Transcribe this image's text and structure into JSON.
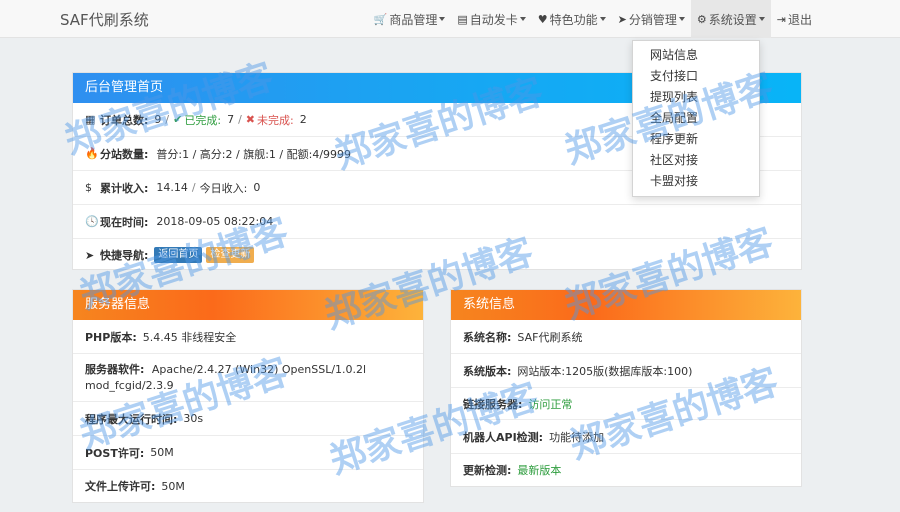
{
  "navbar": {
    "brand": "SAF代刷系统",
    "items": [
      {
        "icon": "cart-icon",
        "glyph": "🛒",
        "label": "商品管理",
        "dropdown": true
      },
      {
        "icon": "book-icon",
        "glyph": "▤",
        "label": "自动发卡",
        "dropdown": true
      },
      {
        "icon": "heart-icon",
        "glyph": "♥",
        "label": "特色功能",
        "dropdown": true
      },
      {
        "icon": "send-icon",
        "glyph": "➤",
        "label": "分销管理",
        "dropdown": true
      },
      {
        "icon": "gear-icon",
        "glyph": "⚙",
        "label": "系统设置",
        "dropdown": true
      },
      {
        "icon": "logout-icon",
        "glyph": "⇥",
        "label": "退出",
        "dropdown": false
      }
    ]
  },
  "dropdown": {
    "items": [
      "网站信息",
      "支付接口",
      "提现列表",
      "全局配置",
      "程序更新",
      "社区对接",
      "卡盟对接"
    ]
  },
  "dashboard": {
    "title": "后台管理首页",
    "orders_label": "订单总数:",
    "orders_total": "9",
    "done_label": "已完成:",
    "done_value": "7",
    "undone_label": "未完成:",
    "undone_value": "2",
    "sites_label": "分站数量:",
    "sites_value": "普分:1 / 高分:2 / 旗舰:1 / 配额:4/9999",
    "income_label": "累计收入:",
    "income_total": "14.14",
    "today_label": "今日收入:",
    "today_value": "0",
    "time_label": "现在时间:",
    "time_value": "2018-09-05 08:22:04",
    "quicknav_label": "快捷导航:",
    "btn_home": "返回首页",
    "btn_second": "检查更新"
  },
  "server": {
    "title": "服务器信息",
    "php_label": "PHP版本:",
    "php_value": "5.4.45 非线程安全",
    "software_label": "服务器软件:",
    "software_value": "Apache/2.4.27 (Win32) OpenSSL/1.0.2l mod_fcgid/2.3.9",
    "maxtime_label": "程序最大运行时间:",
    "maxtime_value": "30s",
    "post_label": "POST许可:",
    "post_value": "50M",
    "upload_label": "文件上传许可:",
    "upload_value": "50M"
  },
  "system": {
    "title": "系统信息",
    "name_label": "系统名称:",
    "name_value": "SAF代刷系统",
    "version_label": "系统版本:",
    "version_value": "网站版本:1205版(数据库版本:100)",
    "link_label": "链接服务器:",
    "link_value": "访问正常",
    "robot_label": "机器人API检测:",
    "robot_value": "功能待添加",
    "update_label": "更新检测:",
    "update_value": "最新版本"
  },
  "watermark": {
    "text": "郑家喜的博客"
  },
  "colors": {
    "blue_header": "#2f8ff0",
    "orange_header": "#f6851f",
    "success": "#2e9d3e",
    "danger": "#d9534f"
  }
}
